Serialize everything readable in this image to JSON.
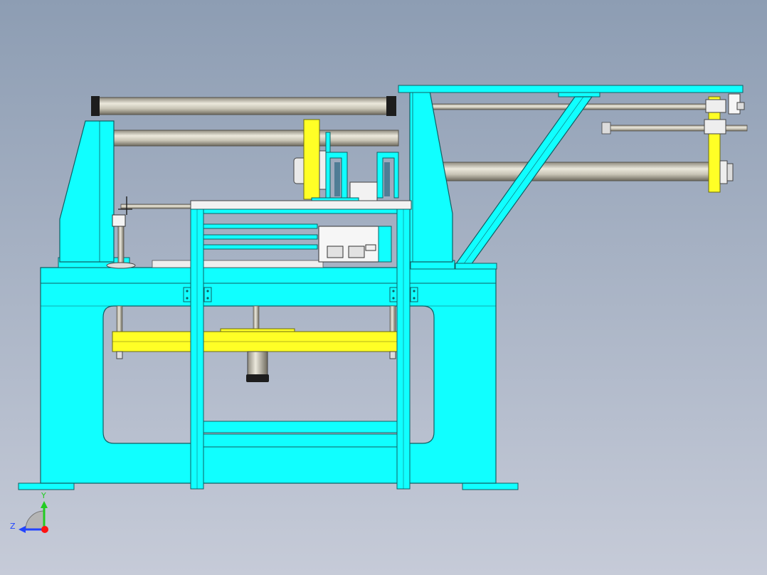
{
  "viewport": {
    "background_top": "#8d9db3",
    "background_bottom": "#c6cbd8"
  },
  "colors": {
    "frame": "#10ffff",
    "frame_edge": "#0f5f63",
    "bracket": "#ffff26",
    "bracket_edge": "#6b6b10",
    "rod": "#c9c5b6",
    "rod_edge": "#55524a",
    "steel_light": "#eeeeee",
    "dark": "#1d1d1d"
  },
  "triad": {
    "y_label": "Y",
    "z_label": "Z",
    "y_color": "#22cc22",
    "z_color": "#2244ff",
    "x_color": "#ff1111"
  }
}
